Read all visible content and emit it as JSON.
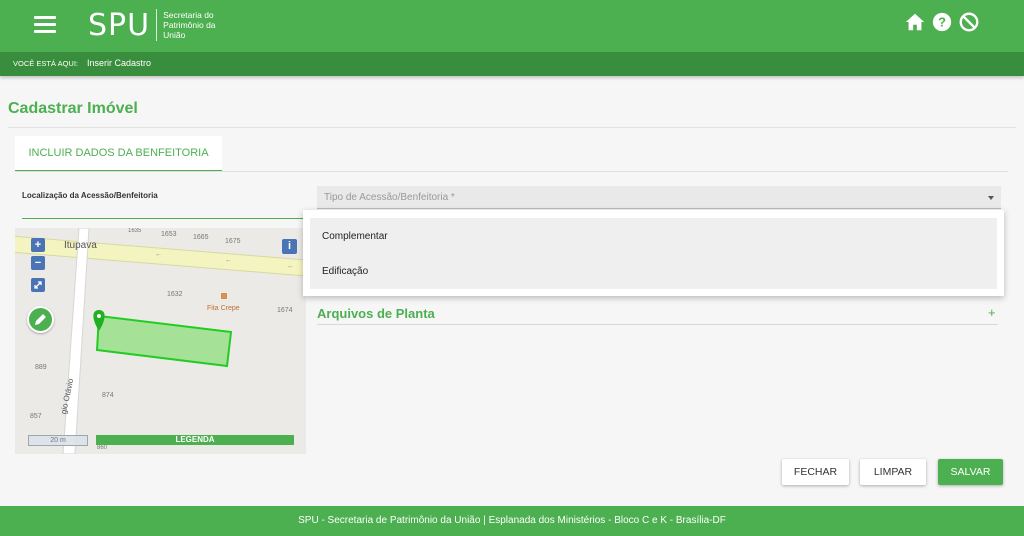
{
  "header": {
    "logo_text": "SPU",
    "logo_sub_1": "Secretaria do",
    "logo_sub_2": "Patrimônio da",
    "logo_sub_3": "União",
    "icons": [
      "home-icon",
      "help-icon",
      "block-icon"
    ]
  },
  "breadcrumb": {
    "label": "VOCÊ ESTÁ AQUI:",
    "current": "Inserir Cadastro"
  },
  "page": {
    "title": "Cadastrar Imóvel",
    "tab_label": "INCLUIR DADOS DA BENFEITORIA",
    "location_label": "Localização da Acessão/Benfeitoria"
  },
  "map": {
    "street_1": "Itupava",
    "street_2": "gio Otávio",
    "poi": "Fita Crepe",
    "numbers": [
      "1653",
      "1665",
      "1675",
      "1632",
      "1674",
      "889",
      "874",
      "857",
      "860",
      "1635"
    ],
    "scale_text": "20 m",
    "legend_label": "LEGENDA",
    "controls": {
      "zoom_in": "+",
      "zoom_out": "−",
      "info": "i"
    }
  },
  "select": {
    "placeholder": "Tipo de Acessão/Benfeitoria *",
    "options": [
      "Complementar",
      "Edificação"
    ]
  },
  "attachments": {
    "title": "Arquivos de Planta",
    "expand": "+"
  },
  "buttons": {
    "close": "FECHAR",
    "clear": "LIMPAR",
    "save": "SALVAR"
  },
  "footer": {
    "text": "SPU - Secretaria de Patrimônio da União | Esplanada dos Ministérios - Bloco C e K - Brasília-DF"
  },
  "colors": {
    "primary": "#4caf50",
    "primary_dark": "#388e3c",
    "map_button": "#4a74b6"
  }
}
